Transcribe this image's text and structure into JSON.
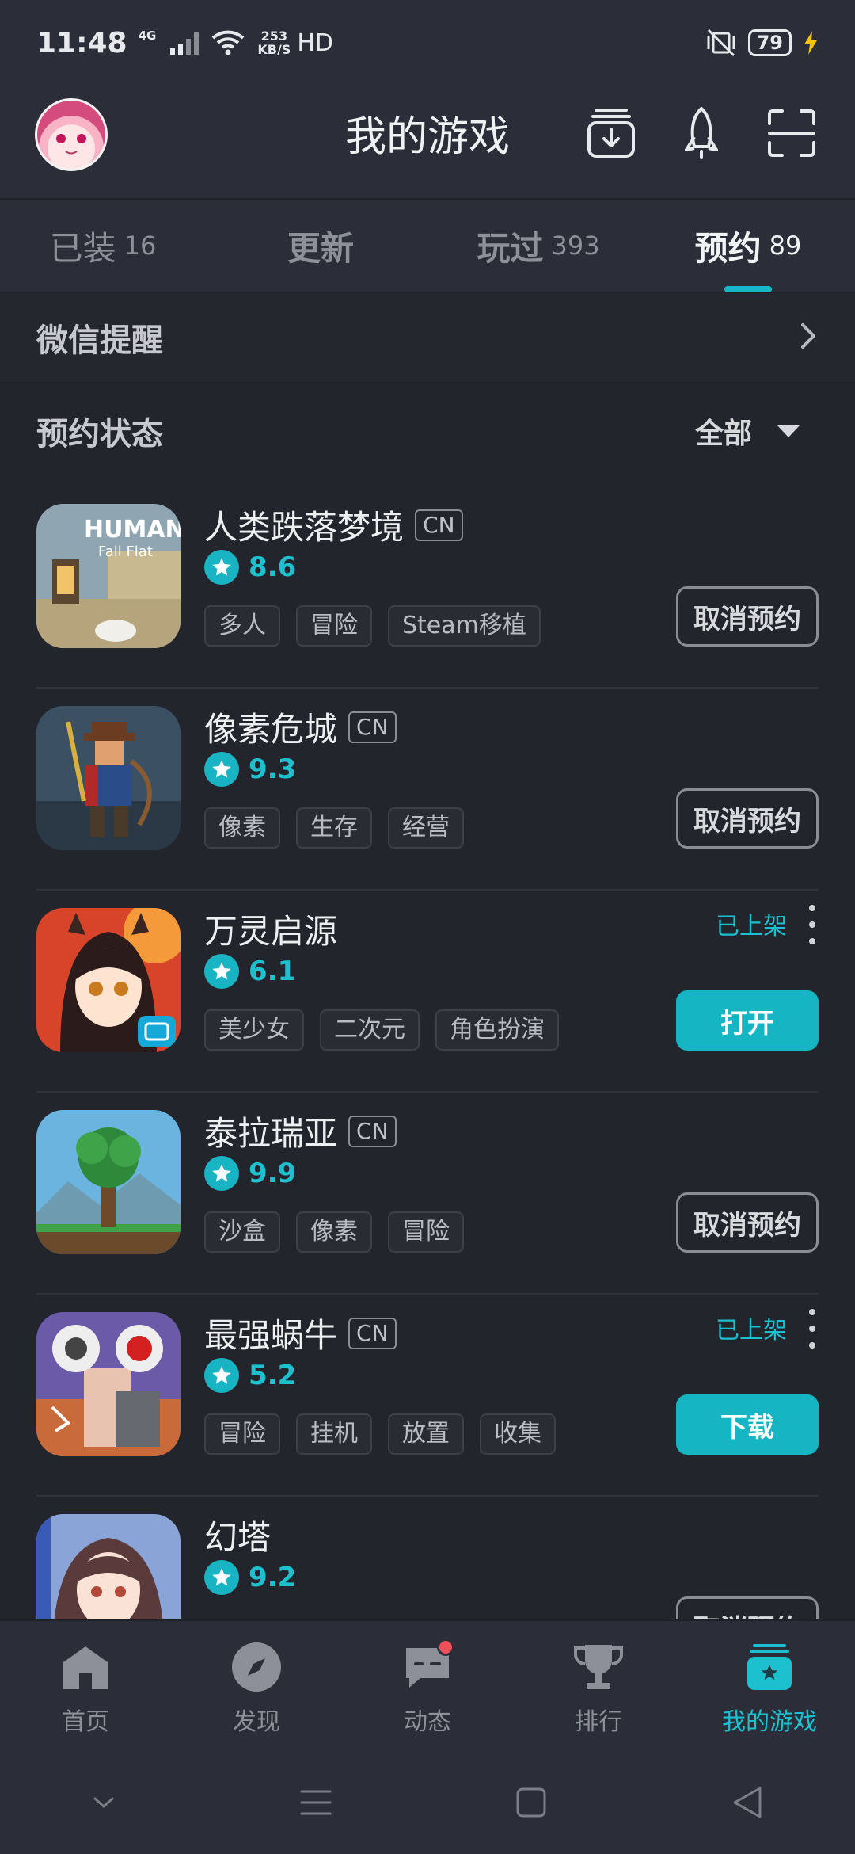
{
  "status_bar": {
    "time": "11:48",
    "network": "4G",
    "speed_value": "253",
    "speed_unit": "KB/S",
    "hd": "HD",
    "battery": "79"
  },
  "header": {
    "title": "我的游戏"
  },
  "tabs": [
    {
      "label": "已装",
      "count": "16"
    },
    {
      "label": "更新",
      "count": ""
    },
    {
      "label": "玩过",
      "count": "393"
    },
    {
      "label": "预约",
      "count": "89",
      "active": true
    }
  ],
  "wechat_reminder": {
    "label": "微信提醒"
  },
  "reservation_status": {
    "label": "预约状态",
    "filter": "全部"
  },
  "games": [
    {
      "name": "人类跌落梦境",
      "badge": "CN",
      "rating": "8.6",
      "tags": [
        "多人",
        "冒险",
        "Steam移植"
      ],
      "button": "取消预约",
      "button_style": "outline",
      "listed": ""
    },
    {
      "name": "像素危城",
      "badge": "CN",
      "rating": "9.3",
      "tags": [
        "像素",
        "生存",
        "经营"
      ],
      "button": "取消预约",
      "button_style": "outline",
      "listed": ""
    },
    {
      "name": "万灵启源",
      "badge": "",
      "rating": "6.1",
      "tags": [
        "美少女",
        "二次元",
        "角色扮演"
      ],
      "button": "打开",
      "button_style": "fill",
      "listed": "已上架"
    },
    {
      "name": "泰拉瑞亚",
      "badge": "CN",
      "rating": "9.9",
      "tags": [
        "沙盒",
        "像素",
        "冒险"
      ],
      "button": "取消预约",
      "button_style": "outline",
      "listed": ""
    },
    {
      "name": "最强蜗牛",
      "badge": "CN",
      "rating": "5.2",
      "tags": [
        "冒险",
        "挂机",
        "放置",
        "收集"
      ],
      "button": "下载",
      "button_style": "fill",
      "listed": "已上架"
    },
    {
      "name": "幻塔",
      "badge": "",
      "rating": "9.2",
      "tags": [],
      "button": "取消预约",
      "button_style": "outline",
      "listed": ""
    }
  ],
  "bottom_nav": [
    {
      "label": "首页",
      "icon": "home-icon"
    },
    {
      "label": "发现",
      "icon": "compass-icon"
    },
    {
      "label": "动态",
      "icon": "chat-icon"
    },
    {
      "label": "排行",
      "icon": "trophy-icon"
    },
    {
      "label": "我的游戏",
      "icon": "my-games-icon",
      "active": true
    }
  ],
  "colors": {
    "accent": "#16b5c4",
    "background": "#23252d",
    "bar": "#2b2e38",
    "notification": "#f0505a"
  }
}
